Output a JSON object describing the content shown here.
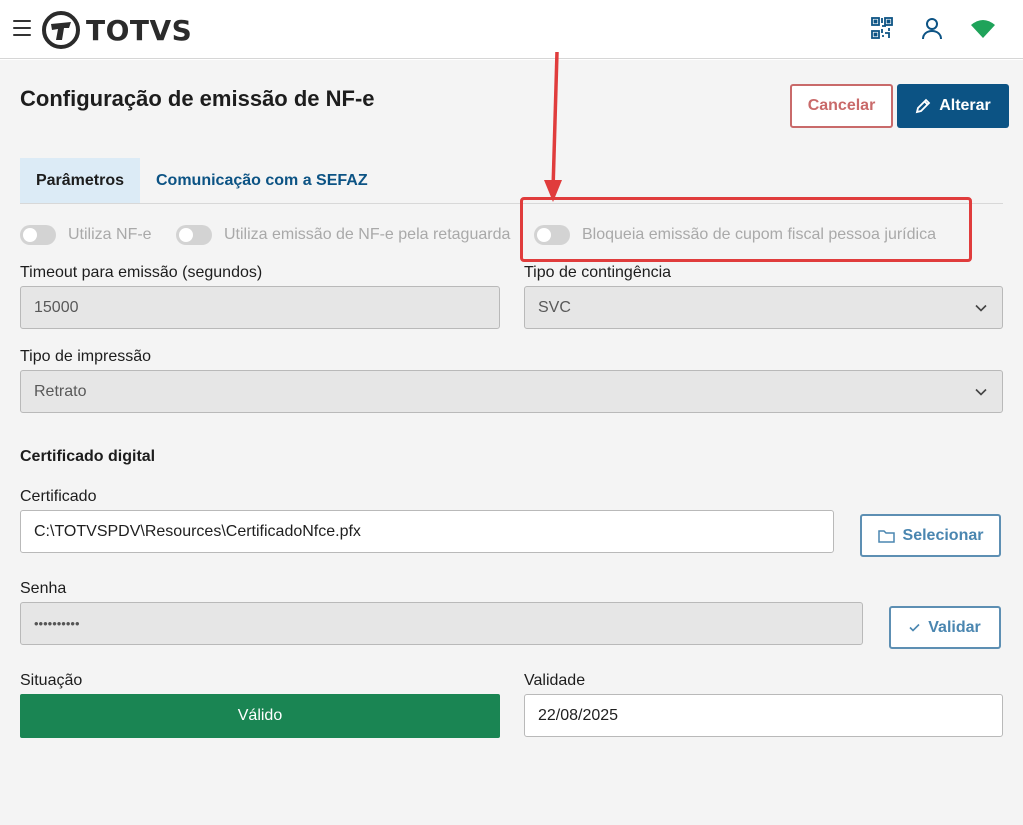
{
  "brand": {
    "name": "TOTVS"
  },
  "header": {
    "icons": [
      "menu-icon",
      "qr-code-icon",
      "user-icon",
      "wifi-icon"
    ],
    "accent_color": "#0c5384",
    "wifi_color": "#1fa35a"
  },
  "page": {
    "title": "Configuração de emissão de NF-e",
    "cancel_label": "Cancelar",
    "alter_label": "Alterar"
  },
  "tabs": [
    {
      "label": "Parâmetros",
      "active": true
    },
    {
      "label": "Comunicação com a SEFAZ",
      "active": false
    }
  ],
  "toggles": [
    {
      "label": "Utiliza NF-e",
      "on": false
    },
    {
      "label": "Utiliza emissão de NF-e pela retaguarda",
      "on": false
    },
    {
      "label": "Bloqueia emissão de cupom fiscal pessoa jurídica",
      "on": false
    }
  ],
  "form": {
    "timeout": {
      "label": "Timeout para emissão (segundos)",
      "value": "15000"
    },
    "contingencia": {
      "label": "Tipo de contingência",
      "value": "SVC"
    },
    "impressao": {
      "label": "Tipo de impressão",
      "value": "Retrato"
    },
    "certificado_section": "Certificado digital",
    "certificado": {
      "label": "Certificado",
      "value": "C:\\TOTVSPDV\\Resources\\CertificadoNfce.pfx"
    },
    "selecionar_label": "Selecionar",
    "senha": {
      "label": "Senha",
      "value": "••••••••••"
    },
    "validar_label": "Validar",
    "situacao": {
      "label": "Situação",
      "value": "Válido",
      "color": "#1a8553"
    },
    "validade": {
      "label": "Validade",
      "value": "22/08/2025"
    }
  }
}
